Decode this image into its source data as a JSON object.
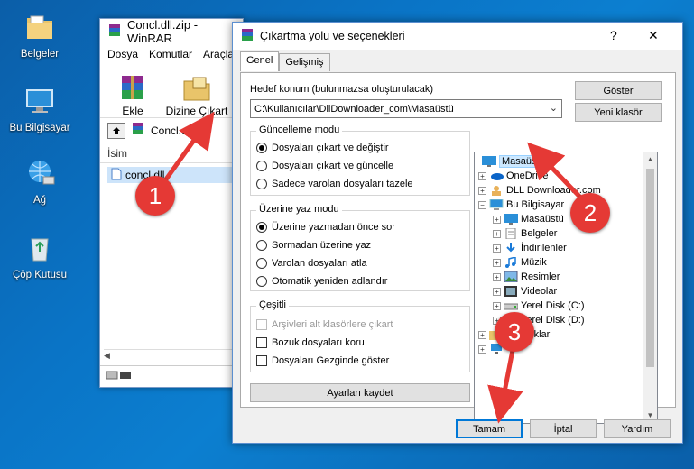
{
  "desktop": {
    "icons": [
      {
        "label": "Belgeler",
        "icon": "folder-documents-icon"
      },
      {
        "label": "Bu Bilgisayar",
        "icon": "computer-icon"
      },
      {
        "label": "Ağ",
        "icon": "network-icon"
      },
      {
        "label": "Çöp Kutusu",
        "icon": "recycle-bin-icon"
      }
    ]
  },
  "winrar": {
    "title": "Concl.dll.zip - WinRAR",
    "menu": [
      "Dosya",
      "Komutlar",
      "Araçlar"
    ],
    "tools": [
      {
        "label": "Ekle",
        "icon": "add-archive-icon"
      },
      {
        "label": "Dizine Çıkart",
        "icon": "extract-to-icon"
      }
    ],
    "path": "Concl.dll.zip",
    "column_name": "İsim",
    "file": "concl.dll"
  },
  "dialog": {
    "title": "Çıkartma yolu ve seçenekleri",
    "help": "?",
    "close": "✕",
    "tabs": [
      "Genel",
      "Gelişmiş"
    ],
    "dest_label": "Hedef konum (bulunmazsa oluşturulacak)",
    "dest_value": "C:\\Kullanıcılar\\DllDownloader_com\\Masaüstü",
    "show_button": "Göster",
    "new_folder_button": "Yeni klasör",
    "update_mode": {
      "title": "Güncelleme modu",
      "options": [
        "Dosyaları çıkart ve değiştir",
        "Dosyaları çıkart ve güncelle",
        "Sadece varolan dosyaları tazele"
      ],
      "selected": 0
    },
    "overwrite_mode": {
      "title": "Üzerine yaz modu",
      "options": [
        "Üzerine yazmadan önce sor",
        "Sormadan üzerine yaz",
        "Varolan dosyaları atla",
        "Otomatik yeniden adlandır"
      ],
      "selected": 0
    },
    "misc": {
      "title": "Çeşitli",
      "options": [
        {
          "label": "Arşivleri alt klasörlere çıkart",
          "checked": false,
          "disabled": true
        },
        {
          "label": "Bozuk dosyaları koru",
          "checked": false,
          "disabled": false
        },
        {
          "label": "Dosyaları Gezginde göster",
          "checked": false,
          "disabled": false
        }
      ]
    },
    "save_settings": "Ayarları kaydet",
    "tree": [
      {
        "label": "Masaüstü",
        "level": 0,
        "expander": "",
        "selected": true,
        "icon": "desktop-folder-icon"
      },
      {
        "label": "OneDrive",
        "level": 1,
        "expander": "+",
        "selected": false,
        "icon": "onedrive-icon"
      },
      {
        "label": "DLL Downloader.com",
        "level": 1,
        "expander": "+",
        "selected": false,
        "icon": "user-folder-icon"
      },
      {
        "label": "Bu Bilgisayar",
        "level": 1,
        "expander": "−",
        "selected": false,
        "icon": "computer-icon"
      },
      {
        "label": "Masaüstü",
        "level": 2,
        "expander": "+",
        "selected": false,
        "icon": "desktop-folder-icon"
      },
      {
        "label": "Belgeler",
        "level": 2,
        "expander": "+",
        "selected": false,
        "icon": "documents-icon"
      },
      {
        "label": "İndirilenler",
        "level": 2,
        "expander": "+",
        "selected": false,
        "icon": "downloads-icon"
      },
      {
        "label": "Müzik",
        "level": 2,
        "expander": "+",
        "selected": false,
        "icon": "music-icon"
      },
      {
        "label": "Resimler",
        "level": 2,
        "expander": "+",
        "selected": false,
        "icon": "pictures-icon"
      },
      {
        "label": "Videolar",
        "level": 2,
        "expander": "+",
        "selected": false,
        "icon": "videos-icon"
      },
      {
        "label": "Yerel Disk (C:)",
        "level": 2,
        "expander": "+",
        "selected": false,
        "icon": "drive-icon"
      },
      {
        "label": "Yerel Disk (D:)",
        "level": 2,
        "expander": "+",
        "selected": false,
        "icon": "drive-icon"
      },
      {
        "label": "Kitaplıklar",
        "level": 1,
        "expander": "+",
        "selected": false,
        "icon": "libraries-icon"
      },
      {
        "label": "",
        "level": 1,
        "expander": "+",
        "selected": false,
        "icon": "network-icon"
      }
    ],
    "ok_button": "Tamam",
    "cancel_button": "İptal",
    "help_button": "Yardım"
  },
  "callouts": [
    "1",
    "2",
    "3"
  ],
  "colors": {
    "accent": "#0078d7",
    "callout": "#e53935",
    "desktop": "#0a74c6"
  }
}
